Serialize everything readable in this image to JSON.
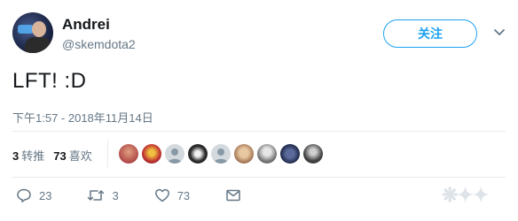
{
  "user": {
    "display_name": "Andrei",
    "handle": "@skemdota2"
  },
  "follow_button": {
    "label": "关注"
  },
  "tweet": {
    "text": "LFT! :D",
    "timestamp": "下午1:57 - 2018年11月14日"
  },
  "stats": {
    "retweets": {
      "count": "3",
      "label": "转推"
    },
    "likes": {
      "count": "73",
      "label": "喜欢"
    }
  },
  "likers_count_shown": 9,
  "actions": {
    "reply_count": "23",
    "retweet_count": "3",
    "like_count": "73"
  },
  "colors": {
    "accent": "#1da1f2",
    "secondary_text": "#657786",
    "divider": "#e6ecf0"
  },
  "icons": {
    "reply": "reply-icon",
    "retweet": "retweet-icon",
    "like": "heart-icon",
    "dm": "envelope-icon",
    "more": "chevron-down-icon"
  }
}
